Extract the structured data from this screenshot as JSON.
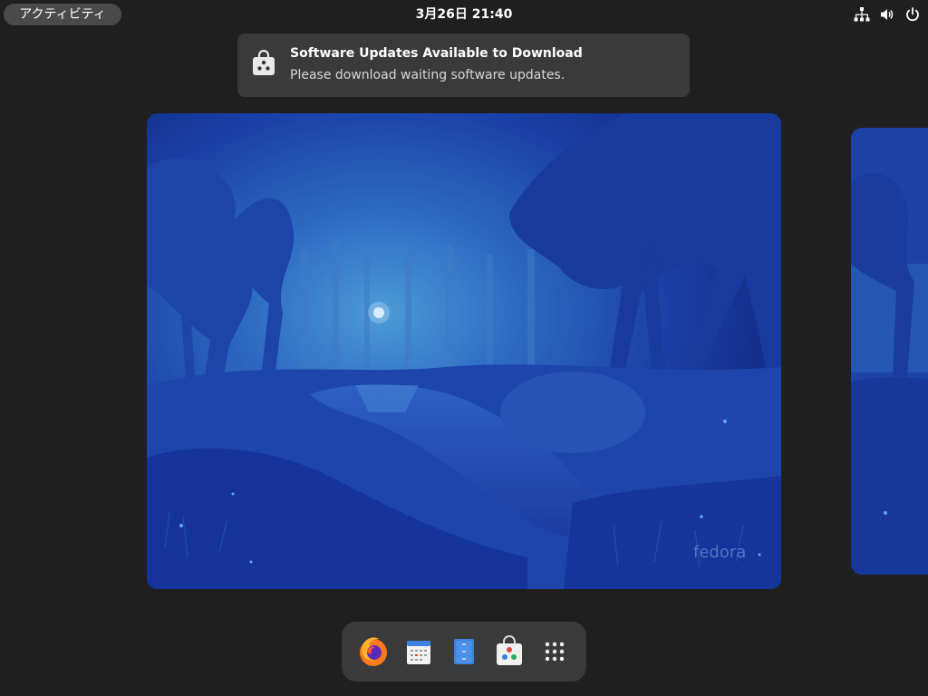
{
  "topbar": {
    "activities_label": "アクティビティ",
    "clock": "3月26日  21:40",
    "tray_icons": [
      "network-icon",
      "volume-icon",
      "power-icon"
    ]
  },
  "notification": {
    "icon": "software-store-icon",
    "title": "Software Updates Available to Download",
    "body": "Please download waiting software updates."
  },
  "workspace": {
    "wallpaper_brand": "fedora"
  },
  "dash": {
    "items": [
      {
        "app": "Firefox",
        "icon": "firefox-icon"
      },
      {
        "app": "Calendar",
        "icon": "calendar-icon"
      },
      {
        "app": "Text Editor",
        "icon": "text-editor-icon"
      },
      {
        "app": "Software",
        "icon": "software-icon"
      },
      {
        "app": "Show Apps",
        "icon": "app-grid-icon"
      }
    ]
  },
  "colors": {
    "background": "#1f1f1f",
    "panel": "#3a3a3a",
    "activities_pill": "#4a4a4a",
    "wallpaper_blue": "#1a3fa8"
  }
}
